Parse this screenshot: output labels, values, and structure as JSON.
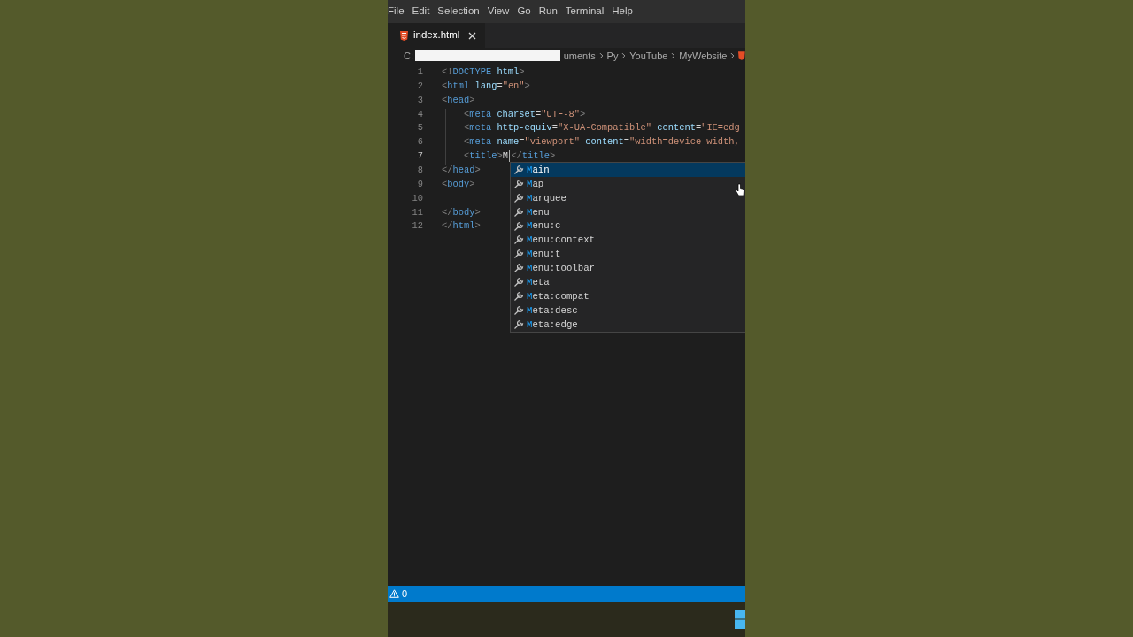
{
  "menu": [
    "File",
    "Edit",
    "Selection",
    "View",
    "Go",
    "Run",
    "Terminal",
    "Help"
  ],
  "tabs": [
    {
      "label": "index.html",
      "selected": true
    }
  ],
  "breadcrumb": [
    "C:",
    "uments",
    "Py",
    "YouTube",
    "MyWebsite"
  ],
  "code_lines": [
    {
      "number": "1",
      "active": false,
      "cursor": false,
      "tokens": [
        {
          "text": "<!",
          "kind": "punct"
        },
        {
          "text": "DOCTYPE",
          "kind": "tag"
        },
        {
          "text": " html",
          "kind": "attr"
        },
        {
          "text": ">",
          "kind": "punct"
        }
      ]
    },
    {
      "number": "2",
      "active": false,
      "cursor": false,
      "tokens": [
        {
          "text": "<",
          "kind": "punct"
        },
        {
          "text": "html",
          "kind": "tag"
        },
        {
          "text": " lang",
          "kind": "attr"
        },
        {
          "text": "=",
          "kind": "plain"
        },
        {
          "text": "\"en\"",
          "kind": "string"
        },
        {
          "text": ">",
          "kind": "punct"
        }
      ]
    },
    {
      "number": "3",
      "active": false,
      "cursor": false,
      "tokens": [
        {
          "text": "<",
          "kind": "punct"
        },
        {
          "text": "head",
          "kind": "tag"
        },
        {
          "text": ">",
          "kind": "punct"
        }
      ]
    },
    {
      "number": "4",
      "active": false,
      "cursor": false,
      "tokens": [
        {
          "text": "    <",
          "kind": "punct"
        },
        {
          "text": "meta",
          "kind": "tag"
        },
        {
          "text": " charset",
          "kind": "attr"
        },
        {
          "text": "=",
          "kind": "plain"
        },
        {
          "text": "\"UTF-8\"",
          "kind": "string"
        },
        {
          "text": ">",
          "kind": "punct"
        }
      ]
    },
    {
      "number": "5",
      "active": false,
      "cursor": false,
      "tokens": [
        {
          "text": "    <",
          "kind": "punct"
        },
        {
          "text": "meta",
          "kind": "tag"
        },
        {
          "text": " http-equiv",
          "kind": "attr"
        },
        {
          "text": "=",
          "kind": "plain"
        },
        {
          "text": "\"X-UA-Compatible\"",
          "kind": "string"
        },
        {
          "text": " content",
          "kind": "attr"
        },
        {
          "text": "=",
          "kind": "plain"
        },
        {
          "text": "\"IE=edg",
          "kind": "string"
        }
      ]
    },
    {
      "number": "6",
      "active": false,
      "cursor": false,
      "tokens": [
        {
          "text": "    <",
          "kind": "punct"
        },
        {
          "text": "meta",
          "kind": "tag"
        },
        {
          "text": " name",
          "kind": "attr"
        },
        {
          "text": "=",
          "kind": "plain"
        },
        {
          "text": "\"viewport\"",
          "kind": "string"
        },
        {
          "text": " content",
          "kind": "attr"
        },
        {
          "text": "=",
          "kind": "plain"
        },
        {
          "text": "\"width=device-width,",
          "kind": "string"
        }
      ]
    },
    {
      "number": "7",
      "active": true,
      "cursor": true,
      "tokens": [
        {
          "text": "    <",
          "kind": "punct"
        },
        {
          "text": "title",
          "kind": "tag"
        },
        {
          "text": ">",
          "kind": "punct"
        },
        {
          "text": "M",
          "kind": "plain"
        },
        {
          "text": "</",
          "kind": "punct"
        },
        {
          "text": "title",
          "kind": "tag"
        },
        {
          "text": ">",
          "kind": "punct"
        }
      ]
    },
    {
      "number": "8",
      "active": false,
      "cursor": false,
      "tokens": [
        {
          "text": "</",
          "kind": "punct"
        },
        {
          "text": "head",
          "kind": "tag"
        },
        {
          "text": ">",
          "kind": "punct"
        }
      ]
    },
    {
      "number": "9",
      "active": false,
      "cursor": false,
      "tokens": [
        {
          "text": "<",
          "kind": "punct"
        },
        {
          "text": "body",
          "kind": "tag"
        },
        {
          "text": ">",
          "kind": "punct"
        }
      ]
    },
    {
      "number": "10",
      "active": false,
      "cursor": false
    },
    {
      "number": "11",
      "active": false,
      "cursor": false,
      "tokens": [
        {
          "text": "</",
          "kind": "punct"
        },
        {
          "text": "body",
          "kind": "tag"
        },
        {
          "text": ">",
          "kind": "punct"
        }
      ]
    },
    {
      "number": "12",
      "active": false,
      "cursor": false,
      "tokens": [
        {
          "text": "</",
          "kind": "punct"
        },
        {
          "text": "html",
          "kind": "tag"
        },
        {
          "text": ">",
          "kind": "punct"
        }
      ]
    }
  ],
  "suggestions": [
    {
      "label": "Main",
      "selected": true
    },
    {
      "label": "Map",
      "selected": false
    },
    {
      "label": "Marquee",
      "selected": false
    },
    {
      "label": "Menu",
      "selected": false
    },
    {
      "label": "Menu:c",
      "selected": false
    },
    {
      "label": "Menu:context",
      "selected": false
    },
    {
      "label": "Menu:t",
      "selected": false
    },
    {
      "label": "Menu:toolbar",
      "selected": false
    },
    {
      "label": "Meta",
      "selected": false
    },
    {
      "label": "Meta:compat",
      "selected": false
    },
    {
      "label": "Meta:desc",
      "selected": false
    },
    {
      "label": "Meta:edge",
      "selected": false
    }
  ],
  "status_bar": {
    "warnings": "0"
  }
}
